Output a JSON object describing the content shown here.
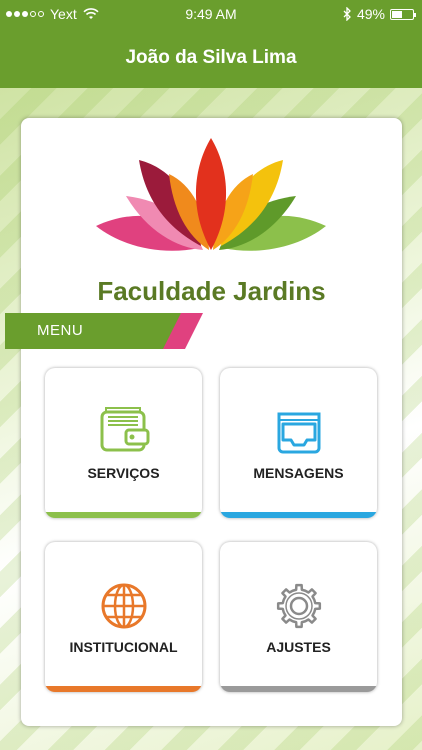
{
  "status_bar": {
    "carrier": "Yext",
    "time": "9:49 AM",
    "battery": "49%",
    "battery_level": 0.49,
    "signal_bars_filled": 3,
    "signal_bars_total": 5
  },
  "header": {
    "title": "João da Silva Lima"
  },
  "logo": {
    "name": "Faculdade Jardins"
  },
  "menu": {
    "label": "MENU",
    "items": [
      {
        "label": "SERVIÇOS",
        "icon": "wallet-icon",
        "color": "#8cc04b"
      },
      {
        "label": "MENSAGENS",
        "icon": "inbox-tray-icon",
        "color": "#2aa7e0"
      },
      {
        "label": "INSTITUCIONAL",
        "icon": "globe-icon",
        "color": "#e8782a"
      },
      {
        "label": "AJUSTES",
        "icon": "gear-icon",
        "color": "#9a9a9a"
      }
    ]
  },
  "colors": {
    "brand_green": "#6a9e2d",
    "logo_text": "#5a7a24",
    "accent_pink": "#e0417f"
  }
}
